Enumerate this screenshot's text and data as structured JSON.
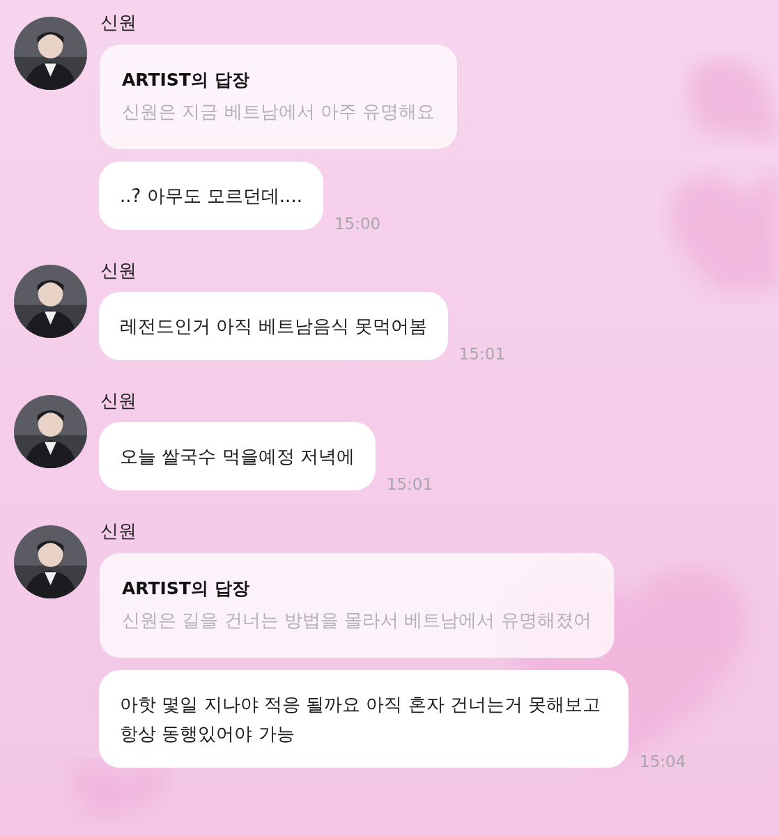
{
  "messages": [
    {
      "sender": "신원",
      "bubbles": [
        {
          "kind": "reply",
          "title": "ARTIST의 답장",
          "text": "신원은 지금 베트남에서 아주 유명해요"
        },
        {
          "kind": "text",
          "text": "..? 아무도 모르던데....",
          "time": "15:00"
        }
      ]
    },
    {
      "sender": "신원",
      "bubbles": [
        {
          "kind": "text",
          "text": "레전드인거 아직 베트남음식 못먹어봄",
          "time": "15:01"
        }
      ]
    },
    {
      "sender": "신원",
      "bubbles": [
        {
          "kind": "text",
          "text": "오늘 쌀국수 먹을예정 저녁에",
          "time": "15:01"
        }
      ]
    },
    {
      "sender": "신원",
      "bubbles": [
        {
          "kind": "reply",
          "title": "ARTIST의 답장",
          "text": "신원은 길을 건너는 방법을 몰라서 베트남에서 유명해졌어"
        },
        {
          "kind": "text",
          "text": "아핫 몇일 지나야 적응 될까요 아직 혼자 건너는거 못해보고 항상 동행있어야 가능",
          "time": "15:04"
        }
      ]
    }
  ]
}
